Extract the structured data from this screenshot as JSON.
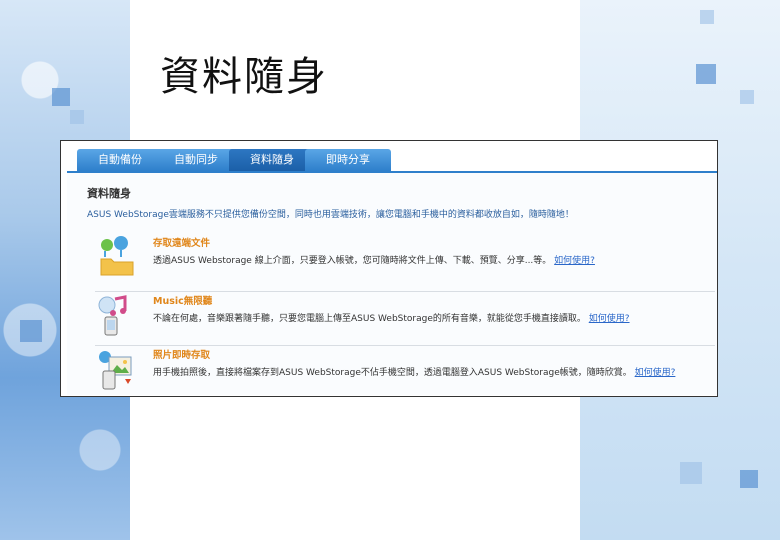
{
  "slide": {
    "title": "資料隨身"
  },
  "tabs": [
    {
      "label": "自動備份"
    },
    {
      "label": "自動同步"
    },
    {
      "label": "資料隨身"
    },
    {
      "label": "即時分享"
    }
  ],
  "section": {
    "title": "資料隨身",
    "description": "ASUS WebStorage雲端服務不只提供您備份空間，同時也用雲端技術，讓您電腦和手機中的資料都收放自如，隨時隨地！"
  },
  "features": [
    {
      "title": "存取遠端文件",
      "text": "透過ASUS Webstorage 線上介面，只要登入帳號，您可隨時將文件上傳、下載、預覽、分享...等。",
      "link": "如何使用?"
    },
    {
      "title": "Music無限聽",
      "text": "不論在何處，音樂跟著隨手聽，只要您電腦上傳至ASUS WebStorage的所有音樂，就能從您手機直接讀取。",
      "link": "如何使用?"
    },
    {
      "title": "照片即時存取",
      "text": "用手機拍照後，直接將檔案存到ASUS WebStorage不佔手機空間，透過電腦登入ASUS WebStorage帳號，隨時欣賞。",
      "link": "如何使用?"
    }
  ],
  "colors": {
    "tab": "#2e7fcb",
    "feature_title": "#e0861a",
    "link": "#2a67c9",
    "description": "#2b5f9e"
  }
}
